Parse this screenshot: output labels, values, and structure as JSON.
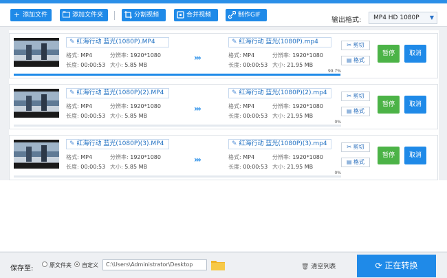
{
  "toolbar": {
    "add_file": "添加文件",
    "add_folder": "添加文件夹",
    "split_video": "分割视频",
    "merge_video": "合并视频",
    "make_gif": "制作GIF",
    "format_label": "输出格式:",
    "format_value": "MP4  HD 1080P",
    "icons": [
      "plus-icon",
      "folder-icon",
      "crop-icon",
      "merge-icon",
      "link-icon"
    ]
  },
  "tasks": [
    {
      "src_name": "红海行动 蓝光(1080P).MP4",
      "dst_name": "红海行动 蓝光(1080P).mp4",
      "src_format_k": "格式:",
      "src_format": "MP4",
      "src_res_k": "分辨率:",
      "src_res": "1920*1080",
      "src_dur_k": "长度:",
      "src_dur": "00:00:53",
      "src_size_k": "大小:",
      "src_size": "5.85 MB",
      "dst_format_k": "格式:",
      "dst_format": "MP4",
      "dst_res_k": "分辨率:",
      "dst_res": "1920*1080",
      "dst_dur_k": "长度:",
      "dst_dur": "00:00:53",
      "dst_size_k": "大小:",
      "dst_size": "21.95 MB",
      "cut": "剪切",
      "format": "格式",
      "pause": "暂停",
      "cancel": "取消",
      "progress_text": "99.7%",
      "progress": 0.997
    },
    {
      "src_name": "红海行动 蓝光(1080P)(2).MP4",
      "dst_name": "红海行动 蓝光(1080P)(2).mp4",
      "src_format_k": "格式:",
      "src_format": "MP4",
      "src_res_k": "分辨率:",
      "src_res": "1920*1080",
      "src_dur_k": "长度:",
      "src_dur": "00:00:53",
      "src_size_k": "大小:",
      "src_size": "5.85 MB",
      "dst_format_k": "格式:",
      "dst_format": "MP4",
      "dst_res_k": "分辨率:",
      "dst_res": "1920*1080",
      "dst_dur_k": "长度:",
      "dst_dur": "00:00:53",
      "dst_size_k": "大小:",
      "dst_size": "21.95 MB",
      "cut": "剪切",
      "format": "格式",
      "pause": "暂停",
      "cancel": "取消",
      "progress_text": "0%",
      "progress": 0
    },
    {
      "src_name": "红海行动 蓝光(1080P)(3).MP4",
      "dst_name": "红海行动 蓝光(1080P)(3).mp4",
      "src_format_k": "格式:",
      "src_format": "MP4",
      "src_res_k": "分辨率:",
      "src_res": "1920*1080",
      "src_dur_k": "长度:",
      "src_dur": "00:00:53",
      "src_size_k": "大小:",
      "src_size": "5.85 MB",
      "dst_format_k": "格式:",
      "dst_format": "MP4",
      "dst_res_k": "分辨率:",
      "dst_res": "1920*1080",
      "dst_dur_k": "长度:",
      "dst_dur": "00:00:53",
      "dst_size_k": "大小:",
      "dst_size": "21.95 MB",
      "cut": "剪切",
      "format": "格式",
      "pause": "暂停",
      "cancel": "取消",
      "progress_text": "0%",
      "progress": 0
    }
  ],
  "bottom": {
    "save_label": "保存至:",
    "original_folder": "原文件夹",
    "custom": "自定义",
    "path": "C:\\Users\\Administrator\\Desktop",
    "clear_list": "清空列表",
    "convert": "正在转换"
  },
  "colors": {
    "accent": "#1f8ae8",
    "pause": "#4cb347"
  }
}
